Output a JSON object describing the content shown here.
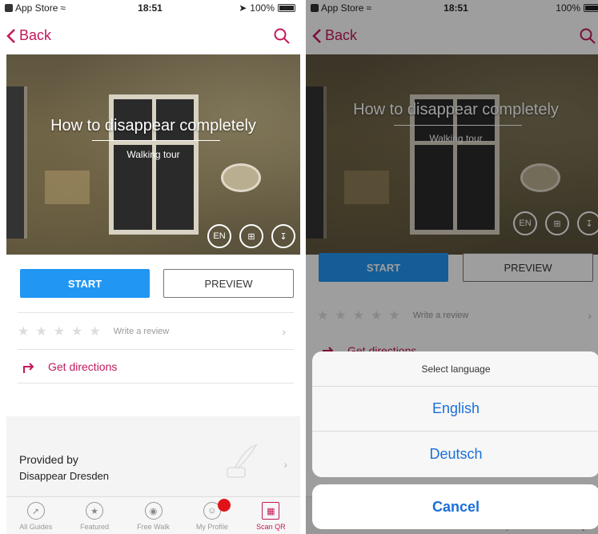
{
  "status_bar": {
    "carrier": "App Store",
    "time": "18:51",
    "battery": "100%"
  },
  "nav": {
    "back_label": "Back"
  },
  "tour": {
    "title": "How to disappear completely",
    "subtitle": "Walking tour",
    "lang_code": "EN"
  },
  "actions": {
    "start_label": "START",
    "preview_label": "PREVIEW"
  },
  "review": {
    "label": "Write a review",
    "rating": 0,
    "max_rating": 5
  },
  "directions": {
    "label": "Get directions"
  },
  "provider": {
    "line1": "Provided by",
    "line2": "Disappear Dresden"
  },
  "tabs": [
    {
      "label": "All Guides",
      "icon": "compass-icon"
    },
    {
      "label": "Featured",
      "icon": "star-icon"
    },
    {
      "label": "Free Walk",
      "icon": "globe-icon"
    },
    {
      "label": "My Profile",
      "icon": "profile-icon"
    },
    {
      "label": "Scan QR",
      "icon": "qr-icon"
    }
  ],
  "language_sheet": {
    "title": "Select language",
    "options": [
      "English",
      "Deutsch"
    ],
    "cancel_label": "Cancel"
  },
  "colors": {
    "accent": "#c2185b",
    "primary_button": "#2196f3",
    "sheet_link": "#1a6fd8",
    "badge": "#e0131b"
  }
}
